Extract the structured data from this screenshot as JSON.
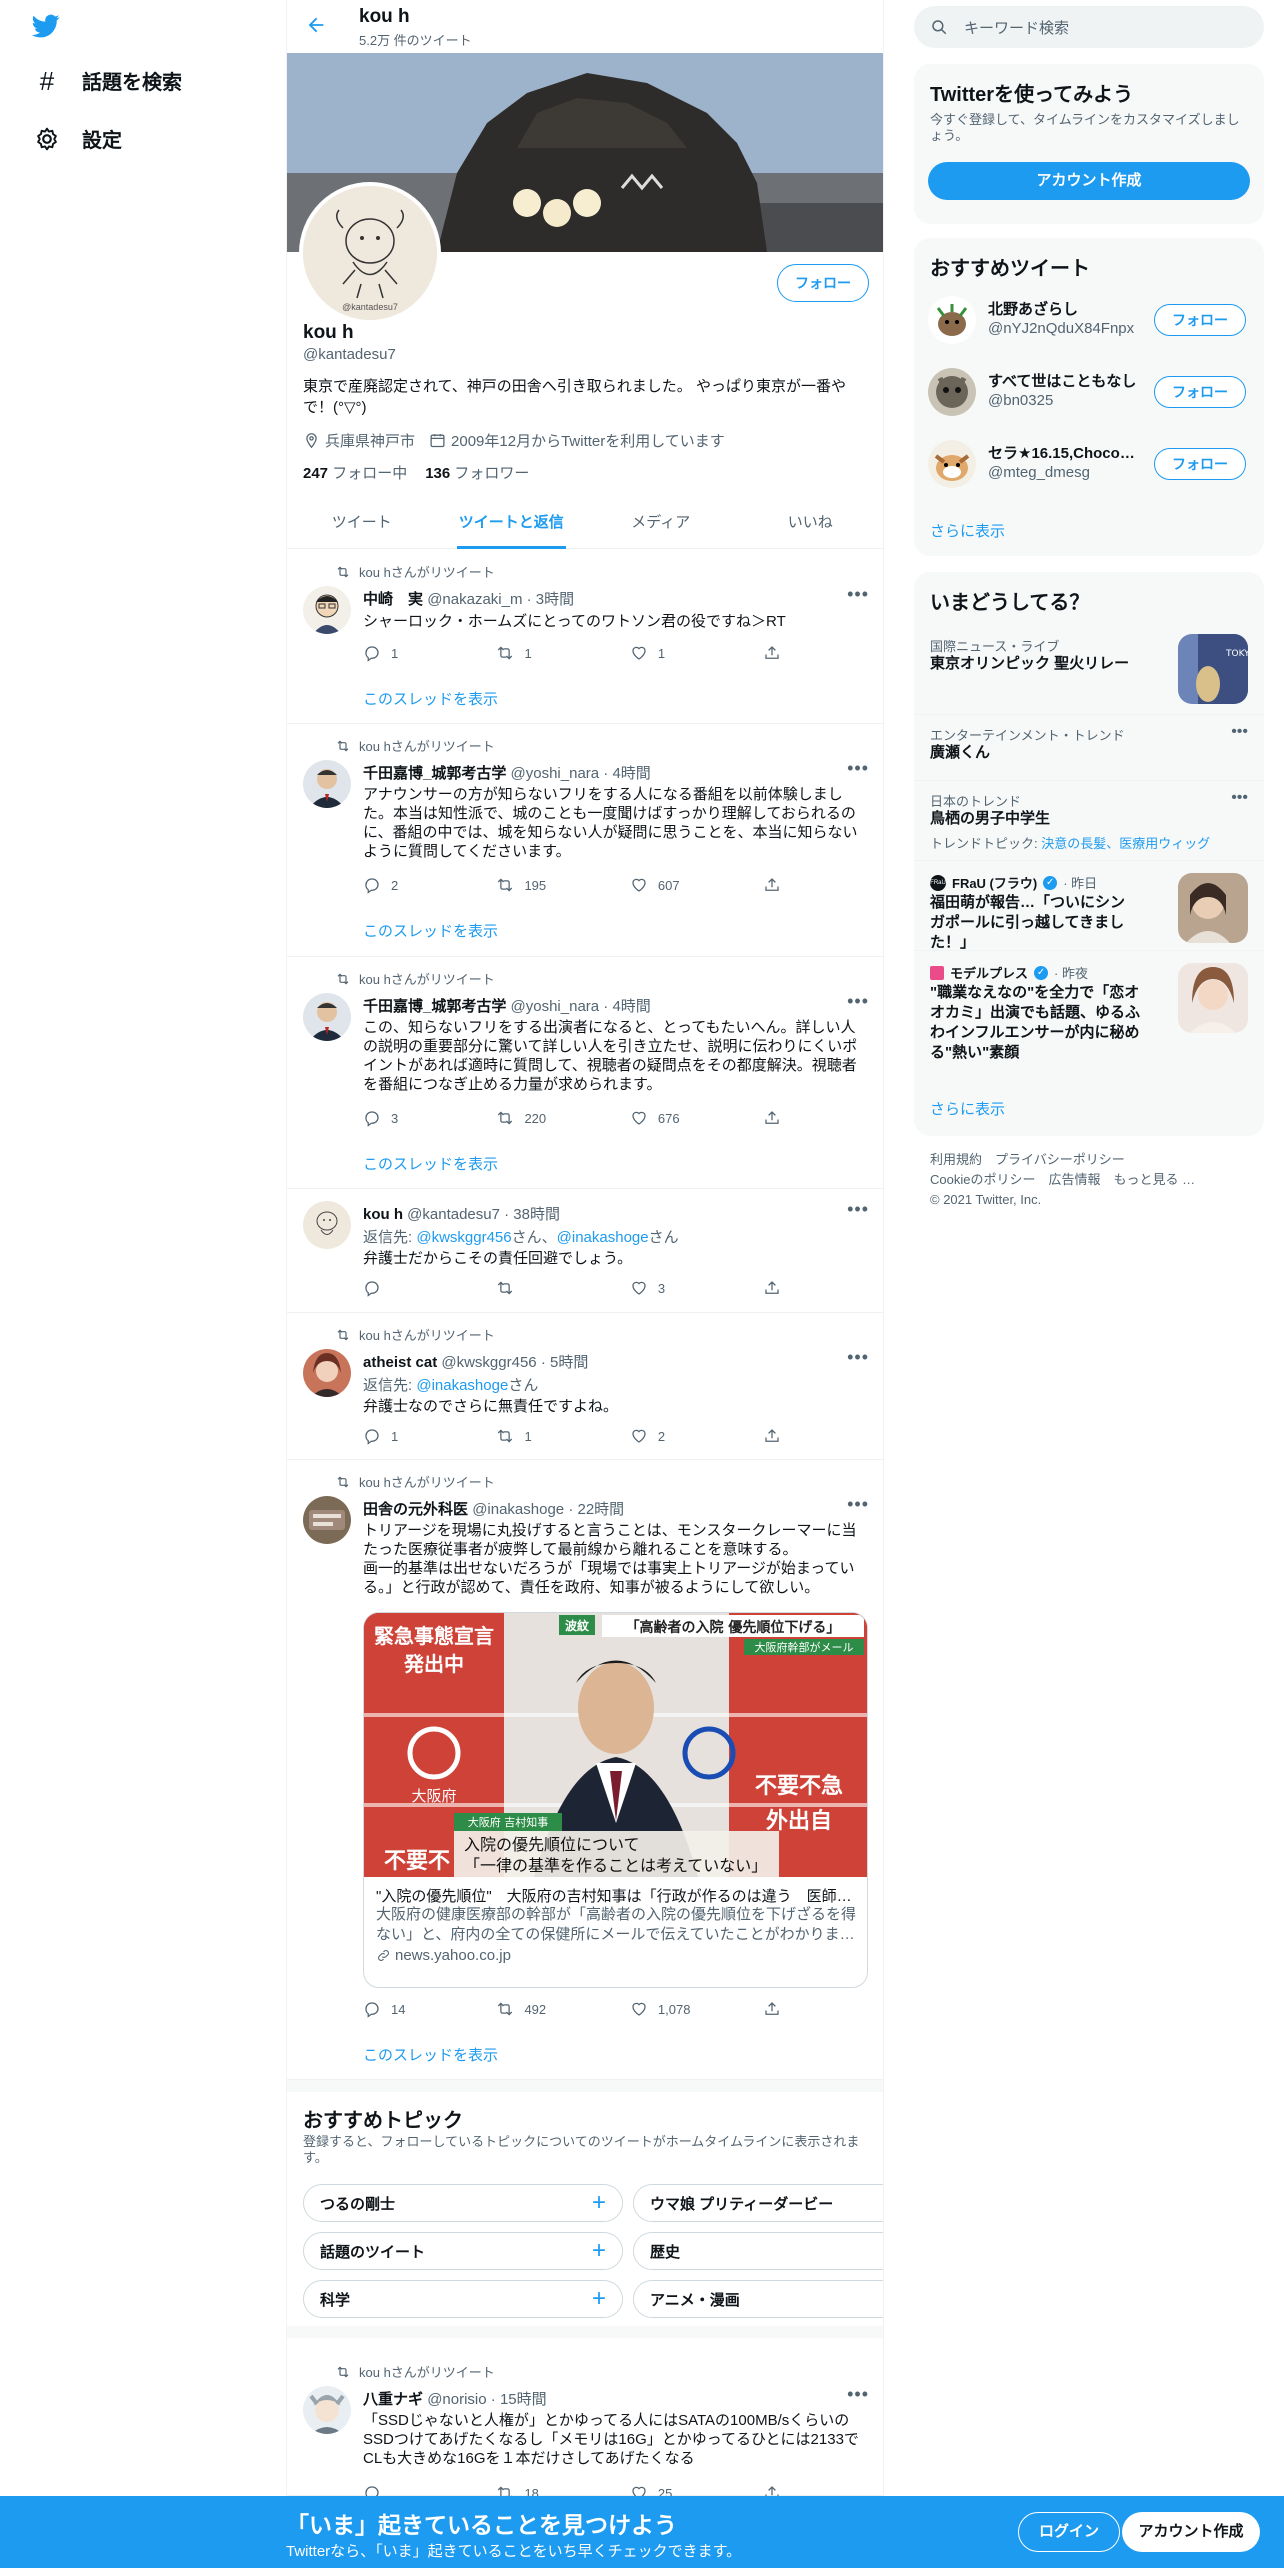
{
  "nav": {
    "items": [
      {
        "label": "話題を検索",
        "icon": "hashtag-icon"
      },
      {
        "label": "設定",
        "icon": "gear-icon"
      }
    ]
  },
  "header": {
    "name": "kou h",
    "tweet_count": "5.2万 件のツイート"
  },
  "profile": {
    "name": "kou h",
    "handle": "@kantadesu7",
    "follow_label": "フォロー",
    "bio": "東京で産廃認定されて、神戸の田舎へ引き取られました。 やっぱり東京が一番やで！(°▽°)",
    "location": "兵庫県神戸市",
    "joined": "2009年12月からTwitterを利用しています",
    "following_count": "247",
    "following_label": "フォロー中",
    "followers_count": "136",
    "followers_label": "フォロワー",
    "avatar_text": "@kantadesu7"
  },
  "tabs": [
    {
      "label": "ツイート"
    },
    {
      "label": "ツイートと返信"
    },
    {
      "label": "メディア"
    },
    {
      "label": "いいね"
    }
  ],
  "tweets": [
    {
      "retweet_by": "kou hさんがリツイート",
      "name": "中崎　実",
      "handle": "@nakazaki_m",
      "time": "· 3時間",
      "text": "シャーロック・ホームズにとってのワトソン君の役ですね＞RT",
      "reply": "1",
      "retweet": "1",
      "like": "1",
      "thread": "このスレッドを表示"
    },
    {
      "retweet_by": "kou hさんがリツイート",
      "name": "千田嘉博_城郭考古学",
      "handle": "@yoshi_nara",
      "time": "· 4時間",
      "text": "アナウンサーの方が知らないフリをする人になる番組を以前体験しました。本当は知性派で、城のことも一度聞けばすっかり理解しておられるのに、番組の中では、城を知らない人が疑問に思うことを、本当に知らないように質問してくださいます。",
      "reply": "2",
      "retweet": "195",
      "like": "607",
      "thread": "このスレッドを表示"
    },
    {
      "retweet_by": "kou hさんがリツイート",
      "name": "千田嘉博_城郭考古学",
      "handle": "@yoshi_nara",
      "time": "· 4時間",
      "text": "この、知らないフリをする出演者になると、とってもたいへん。詳しい人の説明の重要部分に驚いて詳しい人を引き立たせ、説明に伝わりにくいポイントがあれば適時に質問して、視聴者の疑問点をその都度解決。視聴者を番組につなぎ止める力量が求められます。",
      "reply": "3",
      "retweet": "220",
      "like": "676",
      "thread": "このスレッドを表示"
    },
    {
      "name": "kou h",
      "handle": "@kantadesu7",
      "time": "· 38時間",
      "reply_prefix": "返信先: ",
      "reply_user1": "@kwskggr456",
      "reply_mid": "さん、",
      "reply_user2": "@inakashoge",
      "reply_suffix": "さん",
      "text": "弁護士だからこその責任回避でしょう。",
      "reply": "",
      "retweet": "",
      "like": "3"
    },
    {
      "retweet_by": "kou hさんがリツイート",
      "name": "atheist cat",
      "handle": "@kwskggr456",
      "time": "· 5時間",
      "reply_prefix": "返信先: ",
      "reply_user1": "@inakashoge",
      "reply_suffix": "さん",
      "text": "弁護士なのでさらに無責任ですよね。",
      "reply": "1",
      "retweet": "1",
      "like": "2"
    },
    {
      "retweet_by": "kou hさんがリツイート",
      "name": "田舎の元外科医",
      "handle": "@inakashoge",
      "time": "· 22時間",
      "text": "トリアージを現場に丸投げすると言うことは、モンスタークレーマーに当たった医療従事者が疲弊して最前線から離れることを意味する。\n画一的基準は出せないだろうが「現場では事実上トリアージが始まっている。」と行政が認めて、責任を政府、知事が被るようにして欲しい。",
      "card": {
        "title": "\"入院の優先順位\"　大阪府の吉村知事は「行政が作るのは違う　医師…",
        "desc": "大阪府の健康医療部の幹部が「高齢者の入院の優先順位を下げざるを得ない」と、府内の全ての保健所にメールで伝えていたことがわかりま…",
        "domain": "news.yahoo.co.jp",
        "img_banner1": "緊急事態宣言",
        "img_banner2": "発出中",
        "img_tag": "波紋",
        "img_headline": "「高齢者の入院 優先順位下げる」",
        "img_sub": "大阪府幹部がメール",
        "img_role": "大阪府 吉村知事",
        "img_caption1": "入院の優先順位について",
        "img_caption2": "「一律の基準を作ることは考えていない」",
        "img_pref": "大阪府",
        "img_right1": "不要不急",
        "img_right2": "外出自",
        "img_left1": "不要不"
      },
      "reply": "14",
      "retweet": "492",
      "like": "1,078",
      "thread": "このスレッドを表示"
    },
    {
      "retweet_by": "kou hさんがリツイート",
      "name": "八重ナギ",
      "handle": "@norisio",
      "time": "· 15時間",
      "text": "「SSDじゃないと人権が」とかゆってる人にはSATAの100MB/sくらいのSSDつけてあげたくなるし「メモリは16G」とかゆってるひとには2133でCLも大きめな16Gを１本だけさしてあげたくなる",
      "reply": "",
      "retweet": "18",
      "like": "25"
    }
  ],
  "topics": {
    "title": "おすすめトピック",
    "subtitle": "登録すると、フォローしているトピックについてのツイートがホームタイムラインに表示されます。",
    "items": [
      "つるの剛士",
      "ウマ娘 プリティーダービー",
      "話題のツイート",
      "歴史",
      "科学",
      "アニメ・漫画"
    ]
  },
  "search": {
    "placeholder": "キーワード検索"
  },
  "signup": {
    "title": "Twitterを使ってみよう",
    "desc": "今すぐ登録して、タイムラインをカスタマイズしましょう。",
    "button": "アカウント作成"
  },
  "recommended": {
    "title": "おすすめツイート",
    "users": [
      {
        "name": "北野あざらし",
        "handle": "@nYJ2nQduX84Fnpx",
        "button": "フォロー"
      },
      {
        "name": "すべて世はこともなし",
        "handle": "@bn0325",
        "button": "フォロー"
      },
      {
        "name": "セラ★16.15,Chocob…",
        "handle": "@mteg_dmesg",
        "button": "フォロー"
      }
    ],
    "more": "さらに表示"
  },
  "trends": {
    "title": "いまどうしてる？",
    "items": [
      {
        "category": "国際ニュース・ライブ",
        "title": "東京オリンピック 聖火リレー",
        "thumb_text": "TOKYO"
      },
      {
        "category": "エンターテインメント・トレンド",
        "title": "廣瀬くん"
      },
      {
        "category": "日本のトレンド",
        "title": "鳥栖の男子中学生",
        "topics_label": "トレンドトピック: ",
        "topics": "決意の長髪、医療用ウィッグ"
      },
      {
        "source": "FRaU (フラウ)",
        "time": "· 昨日",
        "title": "福田萌が報告…「ついにシンガポールに引っ越してきました！」",
        "source_logo": "FRaU"
      },
      {
        "source": "モデルプレス",
        "time": "· 昨夜",
        "title": "\"職業なえなの\"を全力で「恋オオカミ」出演でも話題、ゆるふわインフルエンサーが内に秘める\"熱い\"素顔"
      }
    ],
    "more": "さらに表示"
  },
  "footer": {
    "line1": "利用規約　プライバシーポリシー",
    "line2": "Cookieのポリシー　広告情報　もっと見る …",
    "line3": "© 2021 Twitter, Inc."
  },
  "bottom": {
    "title": "「いま」起きていることを見つけよう",
    "subtitle": "Twitterなら、「いま」起きていることをいち早くチェックできます。",
    "login": "ログイン",
    "signup": "アカウント作成"
  }
}
